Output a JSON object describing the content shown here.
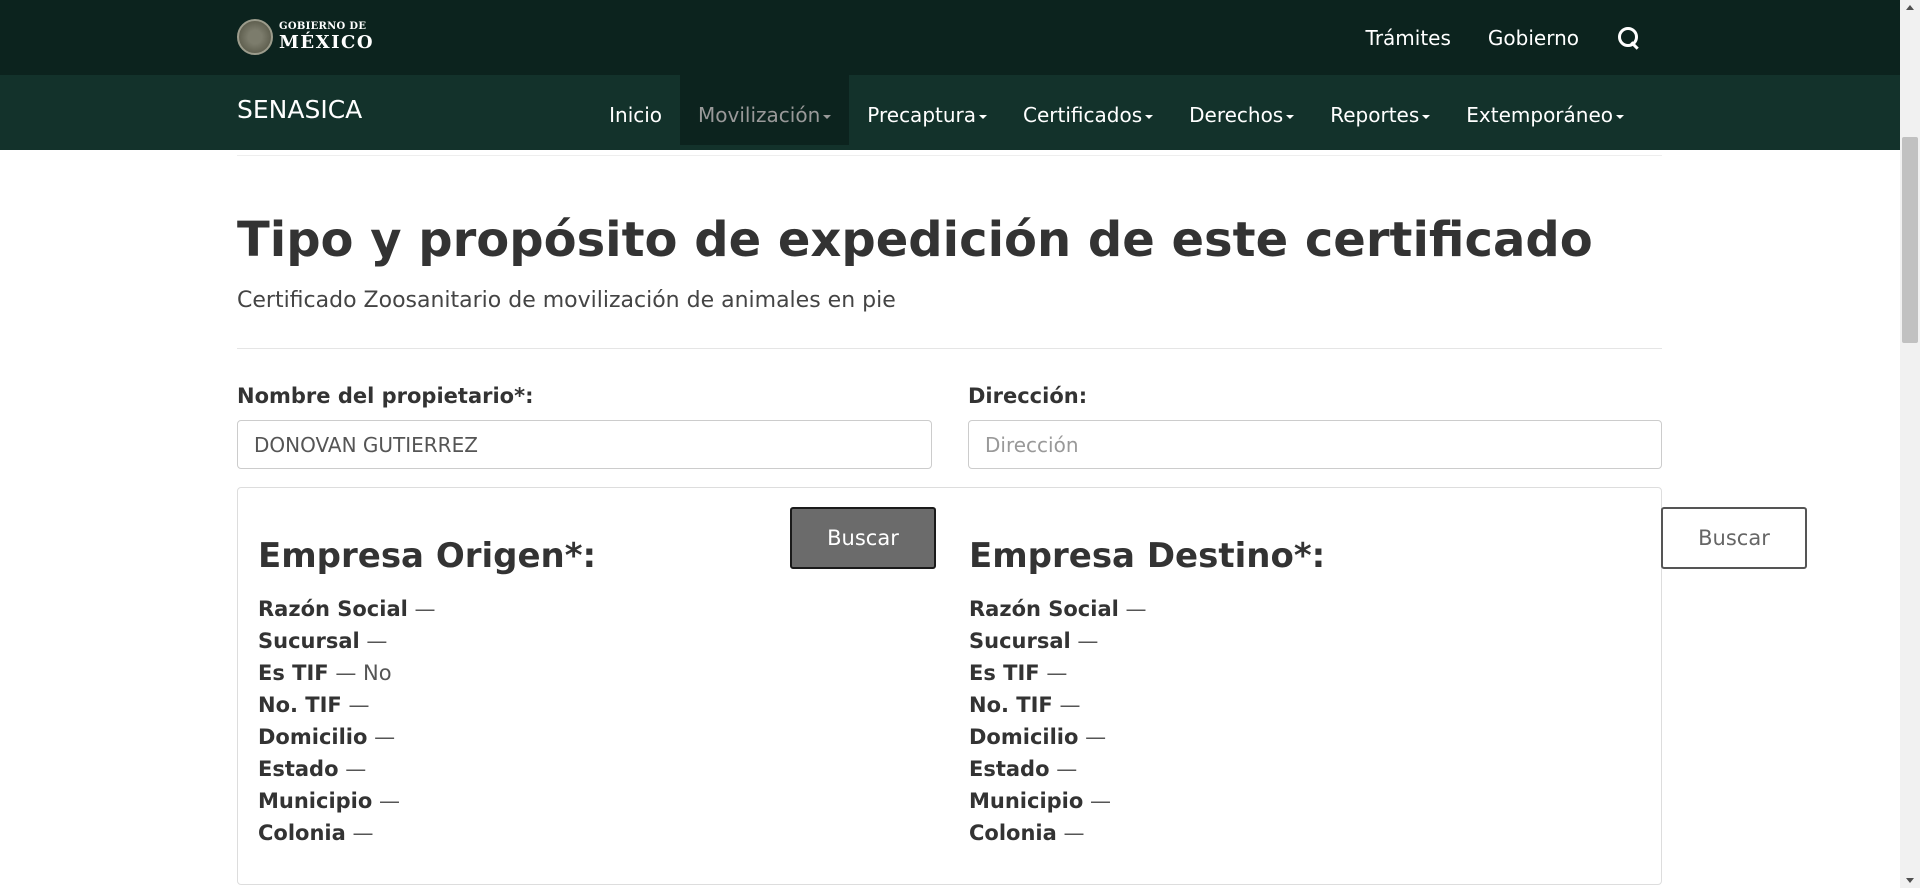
{
  "header": {
    "logo_line1": "GOBIERNO DE",
    "logo_line2": "MÉXICO",
    "links": [
      "Trámites",
      "Gobierno"
    ]
  },
  "navbar": {
    "brand": "SENASICA",
    "items": [
      {
        "label": "Inicio",
        "dropdown": false,
        "active": false
      },
      {
        "label": "Movilización",
        "dropdown": true,
        "active": true
      },
      {
        "label": "Precaptura",
        "dropdown": true,
        "active": false
      },
      {
        "label": "Certificados",
        "dropdown": true,
        "active": false
      },
      {
        "label": "Derechos",
        "dropdown": true,
        "active": false
      },
      {
        "label": "Reportes",
        "dropdown": true,
        "active": false
      },
      {
        "label": "Extemporáneo",
        "dropdown": true,
        "active": false
      }
    ]
  },
  "page": {
    "title": "Tipo y propósito de expedición de este certificado",
    "subtitle": "Certificado Zoosanitario de movilización de animales en pie"
  },
  "form": {
    "owner_label": "Nombre del propietario*:",
    "owner_value": "DONOVAN GUTIERREZ",
    "address_label": "Dirección:",
    "address_value": "",
    "address_placeholder": "Dirección"
  },
  "origin": {
    "title": "Empresa Origen*:",
    "search_label": "Buscar",
    "fields": [
      {
        "label": "Razón Social",
        "value": ""
      },
      {
        "label": "Sucursal",
        "value": ""
      },
      {
        "label": "Es TIF",
        "value": "No"
      },
      {
        "label": "No. TIF",
        "value": ""
      },
      {
        "label": "Domicilio",
        "value": ""
      },
      {
        "label": "Estado",
        "value": ""
      },
      {
        "label": "Municipio",
        "value": ""
      },
      {
        "label": "Colonia",
        "value": ""
      }
    ]
  },
  "destination": {
    "title": "Empresa Destino*:",
    "search_label": "Buscar",
    "fields": [
      {
        "label": "Razón Social",
        "value": ""
      },
      {
        "label": "Sucursal",
        "value": ""
      },
      {
        "label": "Es TIF",
        "value": ""
      },
      {
        "label": "No. TIF",
        "value": ""
      },
      {
        "label": "Domicilio",
        "value": ""
      },
      {
        "label": "Estado",
        "value": ""
      },
      {
        "label": "Municipio",
        "value": ""
      },
      {
        "label": "Colonia",
        "value": ""
      }
    ]
  },
  "separator": "—",
  "colors": {
    "topbar": "#0c231e",
    "navbar": "#13322b",
    "active_nav": "#0c231e",
    "button_filled": "#6b6b6b"
  }
}
